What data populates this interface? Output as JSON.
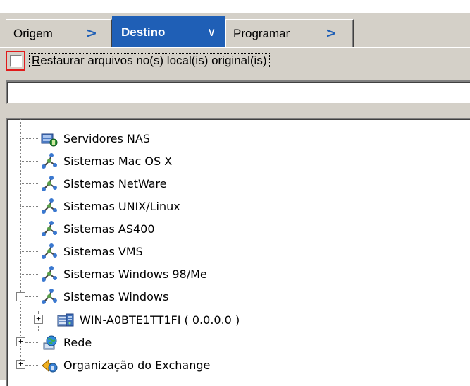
{
  "tabs": [
    {
      "label": "Origem",
      "arrow": ">"
    },
    {
      "label": "Destino",
      "arrow": "∨",
      "active": true
    },
    {
      "label": "Programar",
      "arrow": ">"
    }
  ],
  "restore": {
    "checked": false,
    "label_first": "R",
    "label_rest": "estaurar arquivos no(s) local(is) original(is)"
  },
  "path_input": {
    "value": ""
  },
  "tree": {
    "items": [
      {
        "label": "Servidores NAS",
        "icon": "nas-server-icon"
      },
      {
        "label": "Sistemas Mac OS X",
        "icon": "network-systems-icon"
      },
      {
        "label": "Sistemas NetWare",
        "icon": "network-systems-icon"
      },
      {
        "label": "Sistemas UNIX/Linux",
        "icon": "network-systems-icon"
      },
      {
        "label": "Sistemas AS400",
        "icon": "network-systems-icon"
      },
      {
        "label": "Sistemas VMS",
        "icon": "network-systems-icon"
      },
      {
        "label": "Sistemas Windows 98/Me",
        "icon": "network-systems-icon"
      },
      {
        "label": "Sistemas Windows",
        "icon": "network-systems-icon",
        "expanded": true
      },
      {
        "label": "WIN-A0BTE1TT1FI ( 0.0.0.0 )",
        "icon": "server-computer-icon",
        "collapsed": true
      },
      {
        "label": "Rede",
        "icon": "network-globe-icon",
        "collapsed": true
      },
      {
        "label": "Organização do Exchange",
        "icon": "exchange-organization-icon",
        "collapsed": true
      }
    ]
  },
  "colors": {
    "active_tab": "#1f5fb6",
    "highlight": "#e11a1a",
    "panel": "#d4d0c8"
  }
}
